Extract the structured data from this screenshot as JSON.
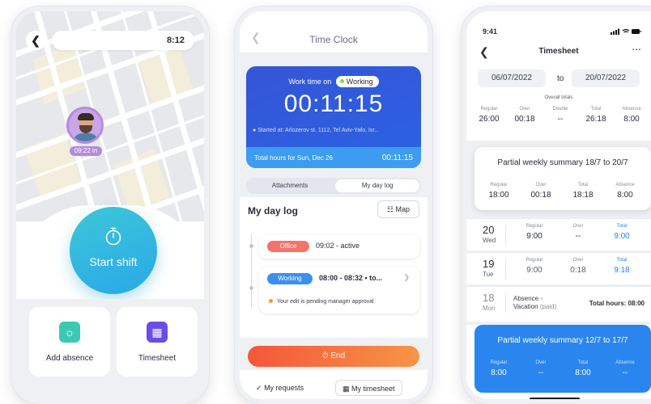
{
  "phone1": {
    "header_time": "8:12",
    "map_time_tag": "09:22 in",
    "start_label": "Start shift",
    "tiles": [
      {
        "label": "Add absence",
        "icon": "sun-icon",
        "color": "#3cc9b4"
      },
      {
        "label": "Timesheet",
        "icon": "timesheet-icon",
        "color": "#6a4de6"
      }
    ]
  },
  "phone2": {
    "title": "Time Clock",
    "work_time_label": "Work time on",
    "status_badge": "Working",
    "timer": "00:11:15",
    "started_at": "Started at: Arlozerov st. 1112, Tel Aviv-Yafo, Isr...",
    "total_label": "Total hours for Sun, Dec 26",
    "total_value": "00:11:15",
    "tabs": [
      "Attachments",
      "My day log"
    ],
    "log_title": "My day log",
    "map_button": "Map",
    "entries": [
      {
        "badge": "Office",
        "text": "09:02 - active",
        "color": "#f4736a"
      },
      {
        "badge": "Working",
        "text": "08:00 - 08:32 • to...",
        "color": "#3b8ff0"
      }
    ],
    "pending_note": "Your edit is pending manager approval",
    "end_button": "End",
    "bottom_links": [
      "My requests",
      "My timesheet"
    ]
  },
  "phone3": {
    "status_time": "9:41",
    "title": "Timesheet",
    "date_from": "06/07/2022",
    "date_to_label": "to",
    "date_to": "20/07/2022",
    "overall_label": "Overall totals",
    "overall": [
      {
        "h": "Regular",
        "v": "26:00"
      },
      {
        "h": "Over",
        "v": "00:18"
      },
      {
        "h": "Double",
        "v": "--"
      },
      {
        "h": "Total",
        "v": "26:18"
      },
      {
        "h": "Absence",
        "v": "8:00"
      }
    ],
    "weekly1": {
      "title": "Partial weekly summary 18/7 to 20/7",
      "cols": [
        {
          "h": "Regular",
          "v": "18:00"
        },
        {
          "h": "Over",
          "v": "00:18"
        },
        {
          "h": "Total",
          "v": "18:18"
        },
        {
          "h": "Absence",
          "v": "8:00"
        }
      ]
    },
    "days": [
      {
        "num": "20",
        "dow": "Wed",
        "regular": "9:00",
        "over": "--",
        "total": "9:00"
      },
      {
        "num": "19",
        "dow": "Tue",
        "regular": "9:00",
        "over": "0:18",
        "total": "9:18"
      }
    ],
    "day_labels": {
      "regular": "Regular",
      "over": "Over",
      "total": "Total"
    },
    "absence_day": {
      "num": "18",
      "dow": "Mon",
      "type": "Absence -",
      "sub": "Vacation",
      "paid": "(paid)",
      "total": "Total hours: 08:00"
    },
    "weekly2": {
      "title": "Partial weekly summary 12/7 to 17/7",
      "cols": [
        {
          "h": "Regular",
          "v": "8:00"
        },
        {
          "h": "Over",
          "v": "--"
        },
        {
          "h": "Total",
          "v": "8:00"
        },
        {
          "h": "Absence",
          "v": "--"
        }
      ]
    }
  }
}
